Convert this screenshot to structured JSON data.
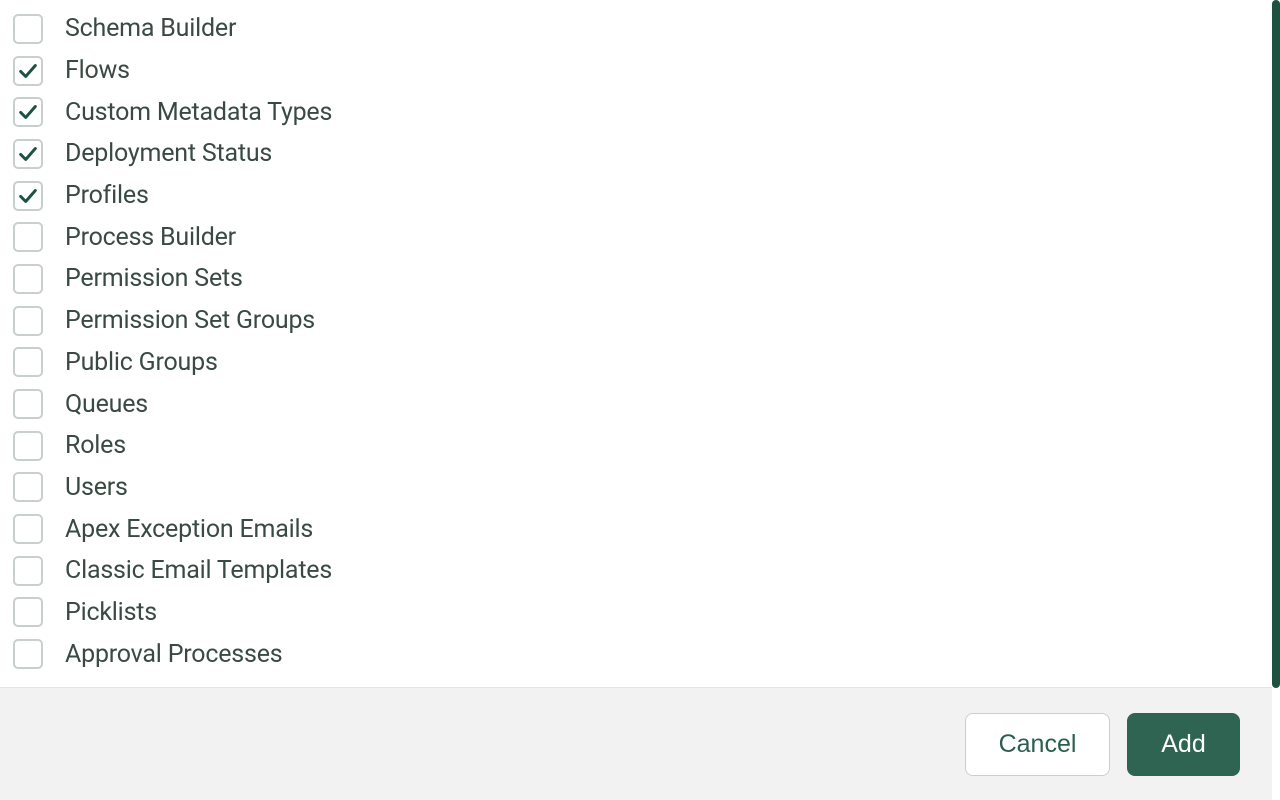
{
  "items": [
    {
      "label": "Schema Builder",
      "checked": false,
      "name": "schema-builder"
    },
    {
      "label": "Flows",
      "checked": true,
      "name": "flows"
    },
    {
      "label": "Custom Metadata Types",
      "checked": true,
      "name": "custom-metadata-types"
    },
    {
      "label": "Deployment Status",
      "checked": true,
      "name": "deployment-status"
    },
    {
      "label": "Profiles",
      "checked": true,
      "name": "profiles"
    },
    {
      "label": "Process Builder",
      "checked": false,
      "name": "process-builder"
    },
    {
      "label": "Permission Sets",
      "checked": false,
      "name": "permission-sets"
    },
    {
      "label": "Permission Set Groups",
      "checked": false,
      "name": "permission-set-groups"
    },
    {
      "label": "Public Groups",
      "checked": false,
      "name": "public-groups"
    },
    {
      "label": "Queues",
      "checked": false,
      "name": "queues"
    },
    {
      "label": "Roles",
      "checked": false,
      "name": "roles"
    },
    {
      "label": "Users",
      "checked": false,
      "name": "users"
    },
    {
      "label": "Apex Exception Emails",
      "checked": false,
      "name": "apex-exception-emails"
    },
    {
      "label": "Classic Email Templates",
      "checked": false,
      "name": "classic-email-templates"
    },
    {
      "label": "Picklists",
      "checked": false,
      "name": "picklists"
    },
    {
      "label": "Approval Processes",
      "checked": false,
      "name": "approval-processes"
    }
  ],
  "buttons": {
    "cancel": "Cancel",
    "add": "Add"
  }
}
